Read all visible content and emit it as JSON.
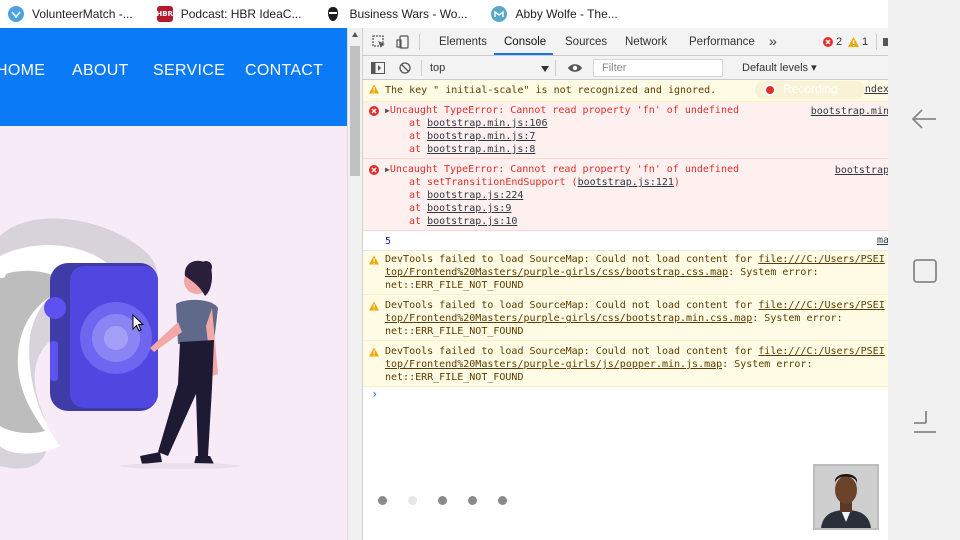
{
  "bookmarks": [
    {
      "label": "VolunteerMatch -...",
      "icon": "volunteermatch-icon",
      "color": "#4aa3df"
    },
    {
      "label": "Podcast: HBR IdeaC...",
      "icon": "hbr-icon",
      "icon_text": "HBR",
      "color": "#b51a2b"
    },
    {
      "label": "Business Wars - Wo...",
      "icon": "business-wars-icon",
      "color": "#1e1e1e"
    },
    {
      "label": "Abby Wolfe - The...",
      "icon": "abby-wolfe-icon",
      "color": "#5aa8c8"
    }
  ],
  "website": {
    "nav_color": "#0b7af6",
    "nav_links": [
      "HOME",
      "ABOUT",
      "SERVICE",
      "CONTACT"
    ],
    "slider_dots": 5,
    "active_dot": 2
  },
  "devtools": {
    "tabs": [
      "Elements",
      "Console",
      "Sources",
      "Network",
      "Performance"
    ],
    "more_tabs": "»",
    "active_tab": "Console",
    "error_count": "2",
    "warning_count": "1",
    "context": "top",
    "filter_placeholder": "Filter",
    "levels": "Default levels ▾",
    "recording_label": "Recording",
    "messages": {
      "m1": {
        "text": "The key \" initial-scale\" is not recognized and ignored.",
        "source": "index"
      },
      "m2": {
        "text": "Uncaught TypeError: Cannot read property 'fn' of undefined",
        "source": "bootstrap.min",
        "stack": [
          {
            "at": "at ",
            "link": "bootstrap.min.js:106"
          },
          {
            "at": "at ",
            "link": "bootstrap.min.js:7"
          },
          {
            "at": "at ",
            "link": "bootstrap.min.js:8"
          }
        ]
      },
      "m3": {
        "text": "Uncaught TypeError: Cannot read property 'fn' of undefined",
        "source": "bootstrap",
        "stack0_prefix": "at setTransitionEndSupport (",
        "stack0_link": "bootstrap.js:121",
        "stack0_suffix": ")",
        "stack": [
          {
            "at": "at ",
            "link": "bootstrap.js:224"
          },
          {
            "at": "at ",
            "link": "bootstrap.js:9"
          },
          {
            "at": "at ",
            "link": "bootstrap.js:10"
          }
        ]
      },
      "m4": {
        "text": "5",
        "source": "ma"
      },
      "m5": {
        "prefix": "DevTools failed to load SourceMap: Could not load content for ",
        "link1": "file:///C:/Users/PSEI",
        "link2": "top/Frontend%20Masters/purple-girls/css/bootstrap.css.map",
        "suffix": ": System error:",
        "tail": "net::ERR_FILE_NOT_FOUND"
      },
      "m6": {
        "prefix": "DevTools failed to load SourceMap: Could not load content for ",
        "link1": "file:///C:/Users/PSEI",
        "link2": "top/Frontend%20Masters/purple-girls/css/bootstrap.min.css.map",
        "suffix": ": System error:",
        "tail": "net::ERR_FILE_NOT_FOUND"
      },
      "m7": {
        "prefix": "DevTools failed to load SourceMap: Could not load content for ",
        "link1": "file:///C:/Users/PSEI",
        "link2": "top/Frontend%20Masters/purple-girls/js/popper.min.js.map",
        "suffix": ": System error:",
        "tail": "net::ERR_FILE_NOT_FOUND"
      }
    },
    "prompt": "›"
  },
  "system_nav": {
    "back": "back-icon",
    "recents": "recents-icon",
    "menu": "menu-icon"
  }
}
